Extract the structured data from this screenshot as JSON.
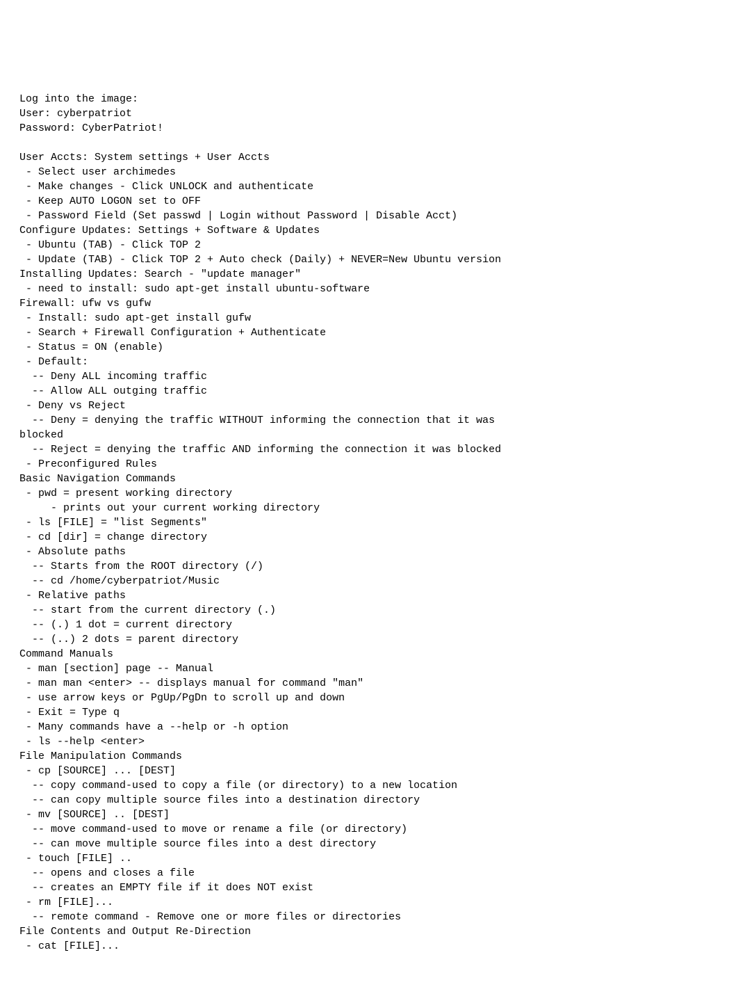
{
  "lines": [
    "Log into the image:",
    "User: cyberpatriot",
    "Password: CyberPatriot!",
    "",
    "User Accts: System settings + User Accts",
    " - Select user archimedes",
    " - Make changes - Click UNLOCK and authenticate",
    " - Keep AUTO LOGON set to OFF",
    " - Password Field (Set passwd | Login without Password | Disable Acct)",
    "Configure Updates: Settings + Software & Updates",
    " - Ubuntu (TAB) - Click TOP 2",
    " - Update (TAB) - Click TOP 2 + Auto check (Daily) + NEVER=New Ubuntu version",
    "Installing Updates: Search - \"update manager\"",
    " - need to install: sudo apt-get install ubuntu-software",
    "Firewall: ufw vs gufw",
    " - Install: sudo apt-get install gufw",
    " - Search + Firewall Configuration + Authenticate",
    " - Status = ON (enable)",
    " - Default:",
    "  -- Deny ALL incoming traffic",
    "  -- Allow ALL outging traffic",
    " - Deny vs Reject",
    "  -- Deny = denying the traffic WITHOUT informing the connection that it was ",
    "blocked",
    "  -- Reject = denying the traffic AND informing the connection it was blocked",
    " - Preconfigured Rules",
    "Basic Navigation Commands",
    " - pwd = present working directory",
    "     - prints out your current working directory",
    " - ls [FILE] = \"list Segments\"",
    " - cd [dir] = change directory",
    " - Absolute paths",
    "  -- Starts from the ROOT directory (/)",
    "  -- cd /home/cyberpatriot/Music",
    " - Relative paths",
    "  -- start from the current directory (.)",
    "  -- (.) 1 dot = current directory",
    "  -- (..) 2 dots = parent directory",
    "Command Manuals",
    " - man [section] page -- Manual",
    " - man man <enter> -- displays manual for command \"man\"",
    " - use arrow keys or PgUp/PgDn to scroll up and down",
    " - Exit = Type q",
    " - Many commands have a --help or -h option",
    " - ls --help <enter>",
    "File Manipulation Commands",
    " - cp [SOURCE] ... [DEST]",
    "  -- copy command-used to copy a file (or directory) to a new location",
    "  -- can copy multiple source files into a destination directory",
    " - mv [SOURCE] .. [DEST]",
    "  -- move command-used to move or rename a file (or directory)",
    "  -- can move multiple source files into a dest directory",
    " - touch [FILE] ..",
    "  -- opens and closes a file",
    "  -- creates an EMPTY file if it does NOT exist",
    " - rm [FILE]...",
    "  -- remote command - Remove one or more files or directories",
    "File Contents and Output Re-Direction",
    " - cat [FILE]..."
  ]
}
